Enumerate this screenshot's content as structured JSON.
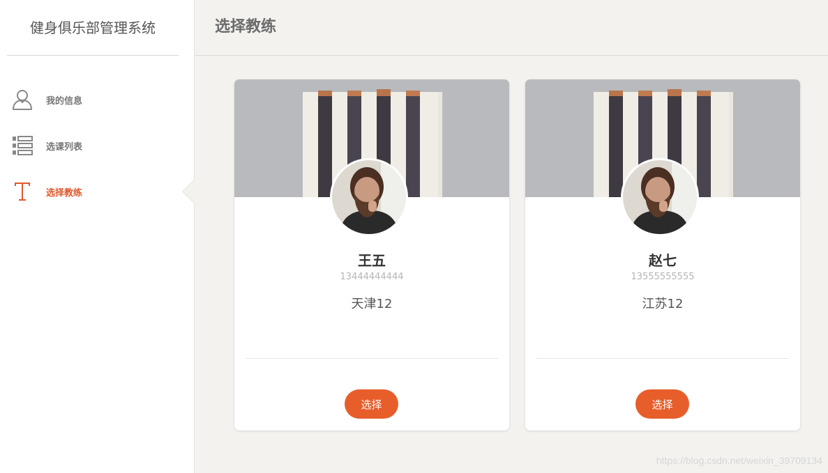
{
  "sidebar": {
    "title": "健身俱乐部管理系统",
    "items": [
      {
        "label": "我的信息",
        "icon": "user-icon",
        "active": false
      },
      {
        "label": "选课列表",
        "icon": "list-icon",
        "active": false
      },
      {
        "label": "选择教练",
        "icon": "text-t-icon",
        "active": true
      }
    ]
  },
  "header": {
    "title": "选择教练"
  },
  "coaches": [
    {
      "name": "王五",
      "phone": "13444444444",
      "address": "天津12",
      "button_label": "选择"
    },
    {
      "name": "赵七",
      "phone": "13555555555",
      "address": "江苏12",
      "button_label": "选择"
    }
  ],
  "watermark": "https://blog.csdn.net/weixin_39709134",
  "colors": {
    "accent": "#e85e2b",
    "active_text": "#e0582b",
    "background": "#f3f2ef"
  }
}
